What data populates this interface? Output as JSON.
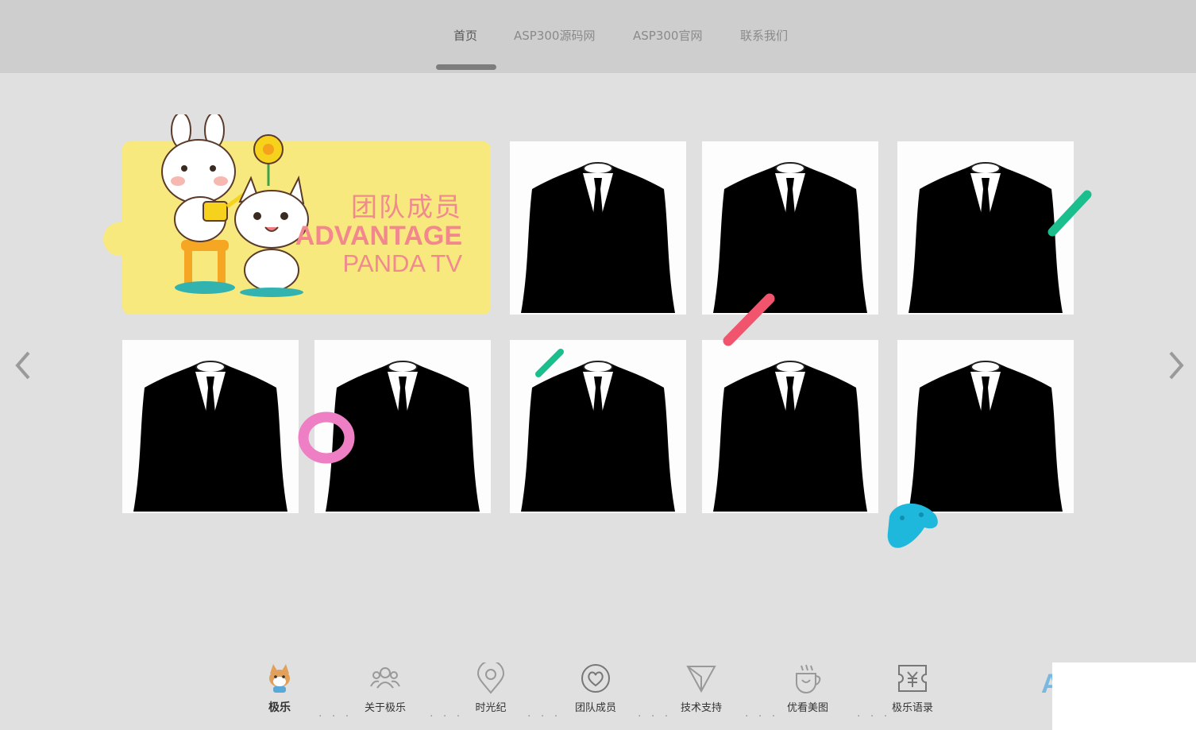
{
  "nav": {
    "items": [
      {
        "label": "首页",
        "active": true
      },
      {
        "label": "ASP300源码网",
        "active": false
      },
      {
        "label": "ASP300官网",
        "active": false
      },
      {
        "label": "联系我们",
        "active": false
      }
    ]
  },
  "banner": {
    "title_cn": "团队成员",
    "title_en": "ADVANTAGE",
    "subtitle_en": "PANDA TV"
  },
  "arrows": {
    "prev_icon": "chevron-left-icon",
    "next_icon": "chevron-right-icon"
  },
  "member_cards": {
    "count": 8,
    "image": "suit-silhouette"
  },
  "decorations": {
    "colors": {
      "green": "#1bbf8e",
      "red": "#f1556e",
      "pink": "#ef7fc4",
      "blue": "#1fb8dd",
      "yellow": "#f8e97f"
    }
  },
  "bottom_nav": {
    "items": [
      {
        "label": "极乐",
        "icon": "shiba-dog-icon",
        "active": true
      },
      {
        "label": "关于极乐",
        "icon": "users-icon",
        "active": false
      },
      {
        "label": "时光纪",
        "icon": "location-pin-icon",
        "active": false
      },
      {
        "label": "团队成员",
        "icon": "heart-circle-icon",
        "active": false
      },
      {
        "label": "技术支持",
        "icon": "paper-plane-icon",
        "active": false
      },
      {
        "label": "优看美图",
        "icon": "coffee-cup-icon",
        "active": false
      },
      {
        "label": "极乐语录",
        "icon": "ticket-icon",
        "active": false
      }
    ],
    "separator": "· · ·",
    "partial_logo": "A"
  }
}
